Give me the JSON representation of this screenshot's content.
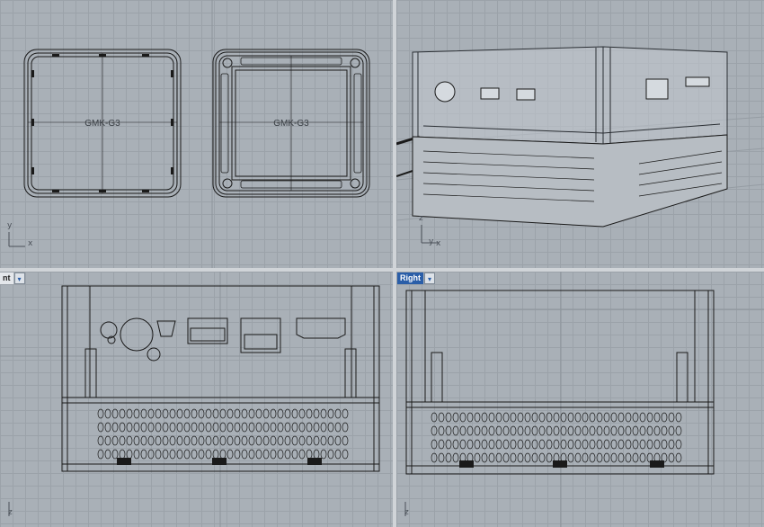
{
  "viewports": {
    "top": {
      "model_label_1": "GMK-G3",
      "model_label_2": "GMK-G3",
      "axis_y": "y",
      "axis_x": "x"
    },
    "perspective": {
      "axis_z": "z",
      "axis_y": "y",
      "axis_x": "x"
    },
    "front": {
      "tab_label": "nt",
      "dropdown_glyph": "▾",
      "axis_z": "z"
    },
    "right": {
      "tab_label": "Right",
      "dropdown_glyph": "▾",
      "axis_z": "z"
    }
  },
  "colors": {
    "active_tab": "#2a5ea8",
    "grid_bg": "#a9b0b7",
    "wire": "#1a1a1a"
  }
}
